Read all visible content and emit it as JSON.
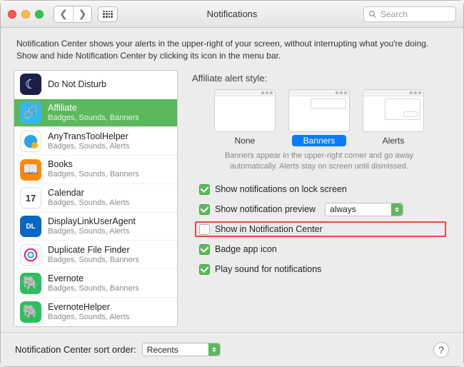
{
  "titlebar": {
    "title": "Notifications",
    "search_placeholder": "Search"
  },
  "intro": "Notification Center shows your alerts in the upper-right of your screen, without interrupting what you're doing. Show and hide Notification Center by clicking its icon in the menu bar.",
  "sidebar": {
    "apps": [
      {
        "name": "Do Not Disturb",
        "sub": "",
        "selected": false,
        "icon_bg": "#1b1f4a",
        "glyph": "☾"
      },
      {
        "name": "Affiliate",
        "sub": "Badges, Sounds, Banners",
        "selected": true,
        "icon_bg": "#35b7f1",
        "glyph": "🔗"
      },
      {
        "name": "AnyTransToolHelper",
        "sub": "Badges, Sounds, Alerts",
        "selected": false,
        "icon_bg": "#ffffff",
        "glyph": ""
      },
      {
        "name": "Books",
        "sub": "Badges, Sounds, Banners",
        "selected": false,
        "icon_bg": "#ff8a00",
        "glyph": "📖"
      },
      {
        "name": "Calendar",
        "sub": "Badges, Sounds, Alerts",
        "selected": false,
        "icon_bg": "#ffffff",
        "glyph": "17"
      },
      {
        "name": "DisplayLinkUserAgent",
        "sub": "Badges, Sounds, Alerts",
        "selected": false,
        "icon_bg": "#0b66c3",
        "glyph": "DL"
      },
      {
        "name": "Duplicate File Finder",
        "sub": "Badges, Sounds, Banners",
        "selected": false,
        "icon_bg": "#ffffff",
        "glyph": "◎"
      },
      {
        "name": "Evernote",
        "sub": "Badges, Sounds, Banners",
        "selected": false,
        "icon_bg": "#2dbe60",
        "glyph": "🐘"
      },
      {
        "name": "EvernoteHelper",
        "sub": "Badges, Sounds, Alerts",
        "selected": false,
        "icon_bg": "#2dbe60",
        "glyph": "🐘"
      }
    ]
  },
  "panel": {
    "style_title": "Affiliate alert style:",
    "styles": [
      {
        "key": "none",
        "label": "None",
        "selected": false
      },
      {
        "key": "banners",
        "label": "Banners",
        "selected": true
      },
      {
        "key": "alerts",
        "label": "Alerts",
        "selected": false
      }
    ],
    "style_hint": "Banners appear in the upper-right corner and go away automatically. Alerts stay on screen until dismissed.",
    "checks": {
      "lock_screen": {
        "label": "Show notifications on lock screen",
        "checked": true
      },
      "preview": {
        "label": "Show notification preview",
        "checked": true,
        "dropdown": "always"
      },
      "in_center": {
        "label": "Show in Notification Center",
        "checked": false
      },
      "badge": {
        "label": "Badge app icon",
        "checked": true
      },
      "sound": {
        "label": "Play sound for notifications",
        "checked": true
      }
    }
  },
  "footer": {
    "sort_label": "Notification Center sort order:",
    "sort_value": "Recents",
    "help": "?"
  }
}
